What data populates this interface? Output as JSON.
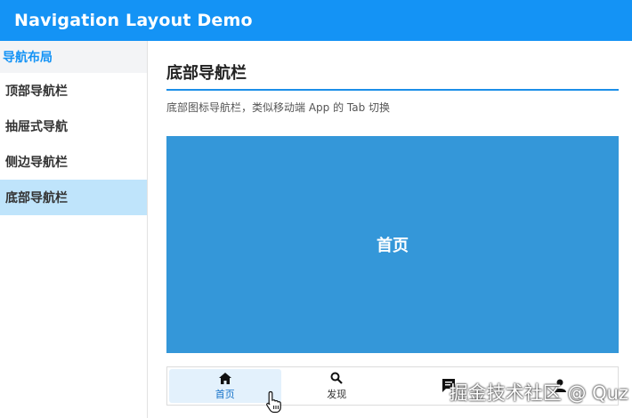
{
  "appbar": {
    "title": "Navigation Layout Demo"
  },
  "sidebar": {
    "header": "导航布局",
    "items": [
      {
        "label": "顶部导航栏",
        "active": false
      },
      {
        "label": "抽屉式导航",
        "active": false
      },
      {
        "label": "侧边导航栏",
        "active": false
      },
      {
        "label": "底部导航栏",
        "active": true
      }
    ]
  },
  "content": {
    "title": "底部导航栏",
    "description": "底部图标导航栏，类似移动端 App 的 Tab 切换",
    "panel_label": "首页"
  },
  "bottom_nav": {
    "tabs": [
      {
        "label": "首页",
        "icon": "home-icon",
        "active": true
      },
      {
        "label": "发现",
        "icon": "search-icon",
        "active": false
      },
      {
        "label": "",
        "icon": "message-icon",
        "active": false
      },
      {
        "label": "",
        "icon": "person-icon",
        "active": false
      }
    ]
  },
  "watermark": "掘金技术社区 @ Quz",
  "colors": {
    "appbar": "#1493f5",
    "active_item": "#bfe4fb",
    "panel": "#3497d9",
    "accent": "#1c8fe8"
  }
}
